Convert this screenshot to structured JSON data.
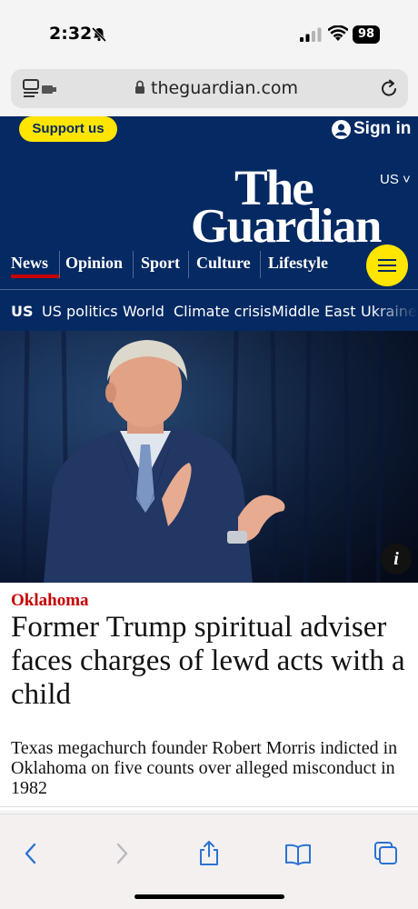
{
  "status_bar": {
    "time": "2:32",
    "battery": "98"
  },
  "browser": {
    "url": "theguardian.com"
  },
  "header": {
    "support_label": "Support us",
    "sign_in_label": "Sign in",
    "edition": "US ˅",
    "logo_line1": "The",
    "logo_line2": "Guardian",
    "brand_color": "#052962",
    "accent_color": "#ffe500"
  },
  "nav": {
    "items": [
      {
        "label": "News",
        "active": true
      },
      {
        "label": "Opinion"
      },
      {
        "label": "Sport"
      },
      {
        "label": "Culture"
      },
      {
        "label": "Lifestyle"
      }
    ],
    "menu_icon": "hamburger-icon"
  },
  "subnav": {
    "items": [
      "US",
      "US politics",
      "World",
      "Climate crisis",
      "Middle East",
      "Ukraine"
    ]
  },
  "article": {
    "kicker": "Oklahoma",
    "kicker_color": "#c70000",
    "headline": "Former Trump spiritual adviser faces charges of lewd acts with a child",
    "standfirst": "Texas megachurch founder Robert Morris indicted in Oklahoma on five counts over alleged misconduct in 1982",
    "info_label": "i"
  },
  "toolbar": {
    "icons": [
      "back-icon",
      "forward-icon",
      "share-icon",
      "bookmarks-icon",
      "tabs-icon"
    ]
  }
}
